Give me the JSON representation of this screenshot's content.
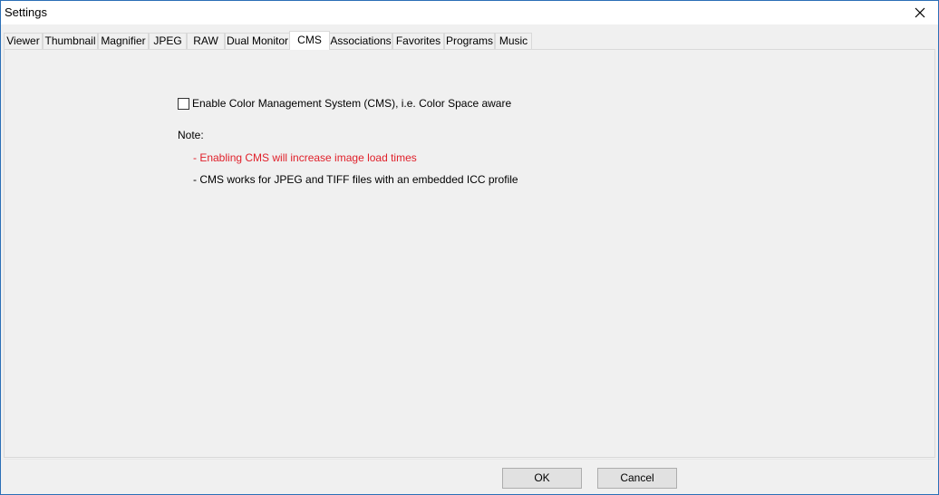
{
  "window": {
    "title": "Settings"
  },
  "tabs": [
    {
      "label": "Viewer"
    },
    {
      "label": "Thumbnail"
    },
    {
      "label": "Magnifier"
    },
    {
      "label": "JPEG"
    },
    {
      "label": "RAW"
    },
    {
      "label": "Dual Monitor"
    },
    {
      "label": "CMS",
      "active": true
    },
    {
      "label": "Associations"
    },
    {
      "label": "Favorites"
    },
    {
      "label": "Programs"
    },
    {
      "label": "Music"
    }
  ],
  "cms": {
    "enable_label": "Enable Color Management System (CMS), i.e. Color Space aware",
    "enable_checked": false,
    "note_label": "Note:",
    "note_line1": "- Enabling CMS will increase image load times",
    "note_line2": "- CMS works for JPEG and TIFF files with an embedded ICC profile",
    "warning_color": "#e0202a"
  },
  "buttons": {
    "ok": "OK",
    "cancel": "Cancel"
  },
  "icons": {
    "close": "close-icon"
  }
}
